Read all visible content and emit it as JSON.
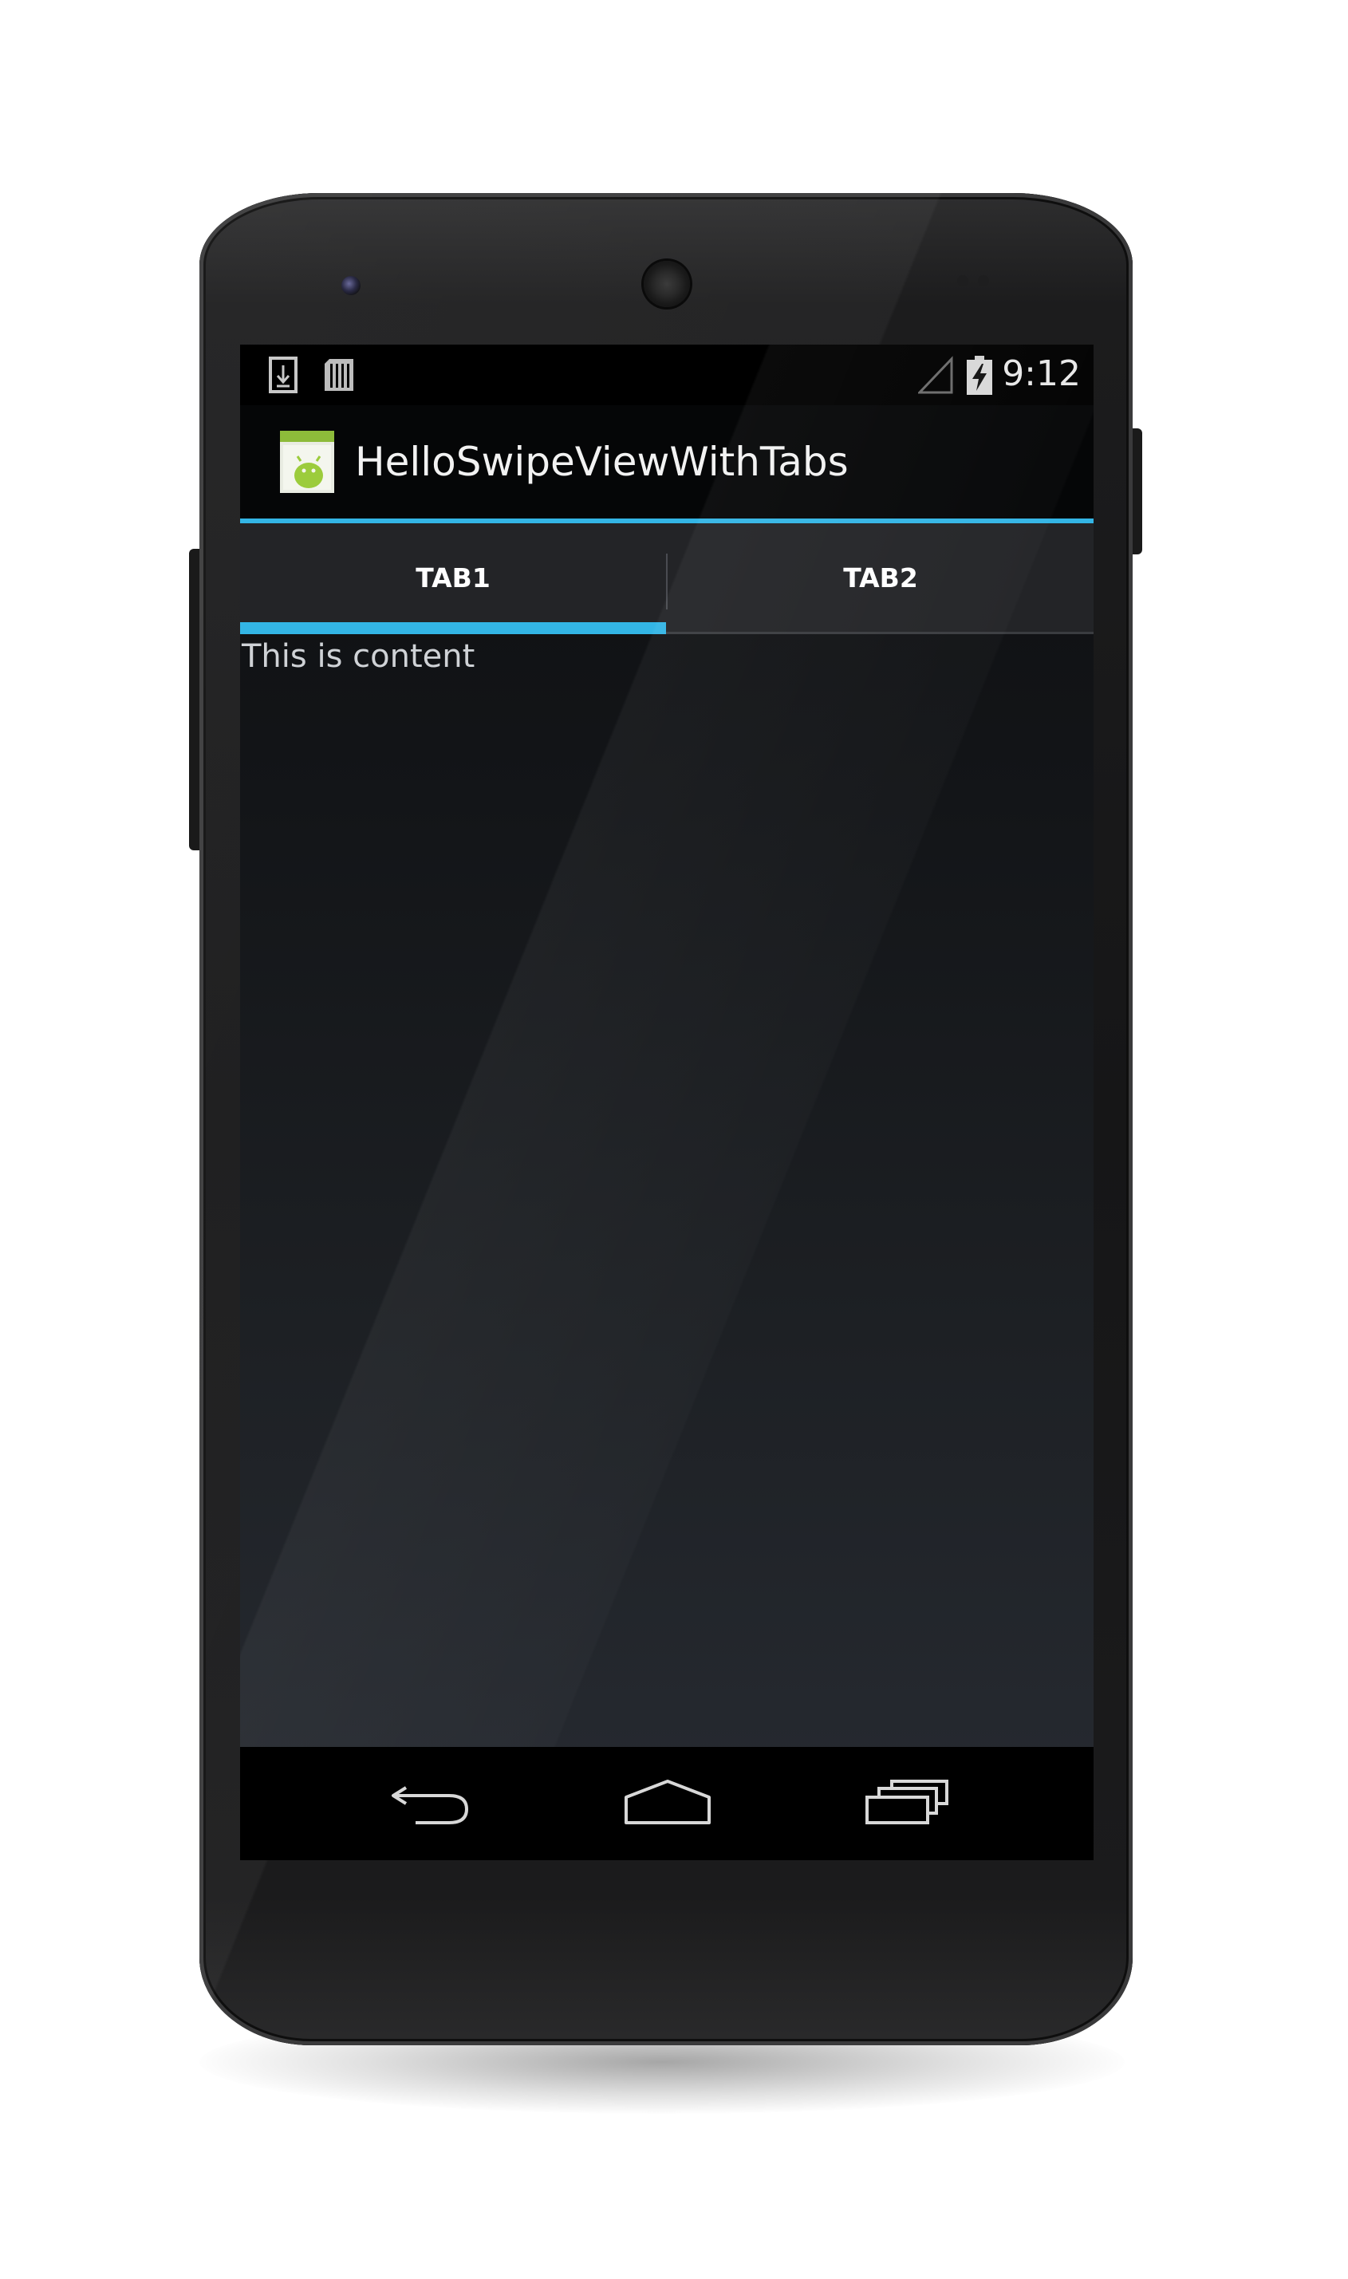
{
  "device": {
    "model": "Android phone",
    "body_color": "#161617",
    "accent_color": "#33b5e5"
  },
  "status_bar": {
    "icons": [
      "download-notification-icon",
      "sim-card-icon",
      "signal-icon",
      "battery-charging-icon"
    ],
    "time": "9:12"
  },
  "action_bar": {
    "app_icon": "android-app-icon",
    "title": "HelloSwipeViewWithTabs"
  },
  "tabs": [
    {
      "label": "TAB1",
      "selected": true
    },
    {
      "label": "TAB2",
      "selected": false
    }
  ],
  "content": {
    "text": "This is content"
  },
  "nav_bar": {
    "buttons": [
      "back-icon",
      "home-icon",
      "recents-icon"
    ]
  }
}
